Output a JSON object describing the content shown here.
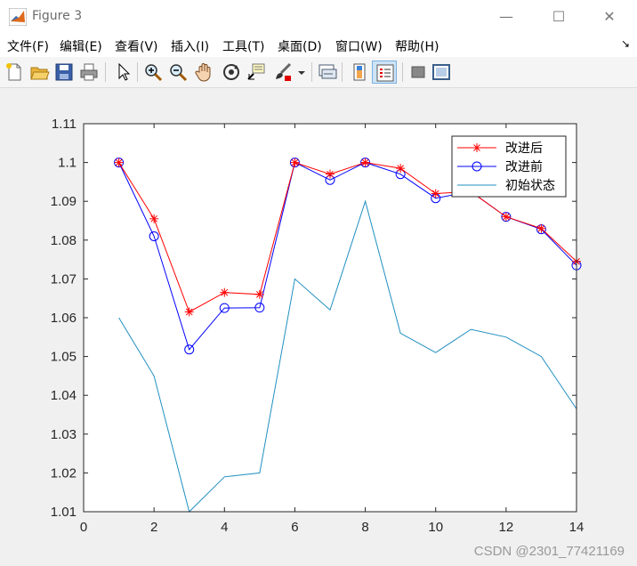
{
  "window": {
    "title": "Figure 3"
  },
  "menu": {
    "items": [
      "文件(F)",
      "编辑(E)",
      "查看(V)",
      "插入(I)",
      "工具(T)",
      "桌面(D)",
      "窗口(W)",
      "帮助(H)"
    ]
  },
  "toolbar": {
    "icons": [
      "new-file-icon",
      "open-folder-icon",
      "save-icon",
      "print-icon",
      "pointer-icon",
      "zoom-in-icon",
      "zoom-out-icon",
      "pan-hand-icon",
      "rotate-3d-icon",
      "data-cursor-icon",
      "brush-icon",
      "dropdown-arrow-icon",
      "link-plot-icon",
      "colorbar-icon",
      "legend-icon",
      "hide-plot-tools-icon",
      "show-plot-tools-icon"
    ]
  },
  "watermark": "CSDN @2301_77421169",
  "chart_data": {
    "type": "line",
    "title": "",
    "xlabel": "",
    "ylabel": "",
    "xlim": [
      0,
      14
    ],
    "ylim": [
      1.01,
      1.11
    ],
    "xticks": [
      "0",
      "2",
      "4",
      "6",
      "8",
      "10",
      "12",
      "14"
    ],
    "yticks": [
      "1.01",
      "1.02",
      "1.03",
      "1.04",
      "1.05",
      "1.06",
      "1.07",
      "1.08",
      "1.09",
      "1.1",
      "1.11"
    ],
    "grid": false,
    "legend_position": "top-right",
    "x": [
      1,
      2,
      3,
      4,
      5,
      6,
      7,
      8,
      9,
      10,
      11,
      12,
      13,
      14
    ],
    "series": [
      {
        "name": "改进后",
        "color": "#ff0000",
        "marker": "asterisk",
        "values": [
          1.1,
          1.0855,
          1.0615,
          1.0665,
          1.066,
          1.1,
          1.097,
          1.1,
          1.0985,
          1.092,
          1.0925,
          1.086,
          1.083,
          1.0745
        ]
      },
      {
        "name": "改进前",
        "color": "#0000ff",
        "marker": "circle",
        "values": [
          1.1,
          1.081,
          1.0518,
          1.0625,
          1.0626,
          1.1,
          1.0955,
          1.1,
          1.097,
          1.0908,
          1.0925,
          1.086,
          1.0828,
          1.0735
        ]
      },
      {
        "name": "初始状态",
        "color": "#1f8fc0",
        "marker": "none",
        "values": [
          1.06,
          1.045,
          1.01,
          1.019,
          1.02,
          1.07,
          1.062,
          1.09,
          1.056,
          1.051,
          1.057,
          1.055,
          1.05,
          1.0365
        ]
      }
    ]
  }
}
